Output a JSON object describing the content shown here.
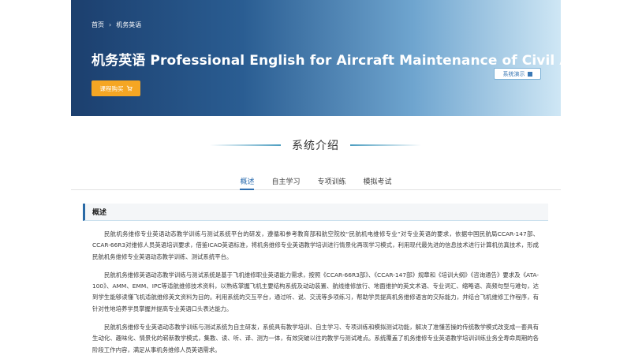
{
  "breadcrumb": {
    "home": "首页",
    "separator": "›",
    "current": "机务英语"
  },
  "banner": {
    "title": "机务英语 Professional English for Aircraft Maintenance of Civil Aviation",
    "buy_label": "课程购买",
    "buy_icon": "cart-icon",
    "demo_label": "系统演示",
    "demo_icon": "document-icon",
    "gradient": [
      "#1c3f6e",
      "#2a5d92",
      "#6fa5cf",
      "#cfe7f5"
    ]
  },
  "section": {
    "title": "系统介绍"
  },
  "tabs": [
    {
      "label": "概述",
      "active": true
    },
    {
      "label": "自主学习",
      "active": false
    },
    {
      "label": "专项训练",
      "active": false
    },
    {
      "label": "模拟考试",
      "active": false
    }
  ],
  "overview": {
    "heading": "概述",
    "paragraphs": [
      "民航机务维修专业英语动态教学训练与测试系统平台的研发，遵循和参考教育部和航空院校“民航机电维修专业”对专业英语的要求，依据中国民航局CCAR-147部、CCAR-66R3对维修人员英语培训要求，借鉴ICAO英语标准，将机务维修专业英语教学培训进行情景化再现学习模式，利用现代最先进的信息技术进行计算机仿真技术，形成民航机务维修专业英语动态教学训练、测试系统平台。",
      "民航机务维修英语动态教学训练与测试系统是基于飞机维修职业英语能力需求，按照《CCAR-66R3部》、《CCAR-147部》规章和《培训大纲》《咨询通告》要求及《ATA-100》、AMM、EMM、IPC等适航维修技术资料，以熟练掌握飞机主要结构系统及动动装置、航线维修放行、地面维护的英文术语、专业词汇、缩略语、高频句型与难句，达到学生能够读懂飞机适航维修英文资料为目的。利用系统的交互平台，通过听、说、交流等多项练习，帮助学员提高机务维修语言的交际能力，并结合飞机维修工作程序，有针对性地培养学员掌握并提高专业英语口头表达能力。",
      "民航机务维修专业英语动态教学训练与测试系统为自主研发，系统具有教学培训、自主学习、专项训练和模拟测试功能，解决了准懂苦操的传统教学模式改变成一套具有生动化、趣味化、情景化的崭新教学模式，集教、读、听、译、测为一体，有效突破以往的教学与测试难点。系统覆盖了机务维修专业英语教学培训训练业务全寿命周期的各阶段工作内容，满足从事机务维修人员英语需求。"
    ]
  },
  "colors": {
    "accent": "#2f6fb0",
    "buy_button": "#f5a623",
    "heading_bar": "#2a6aa6"
  }
}
